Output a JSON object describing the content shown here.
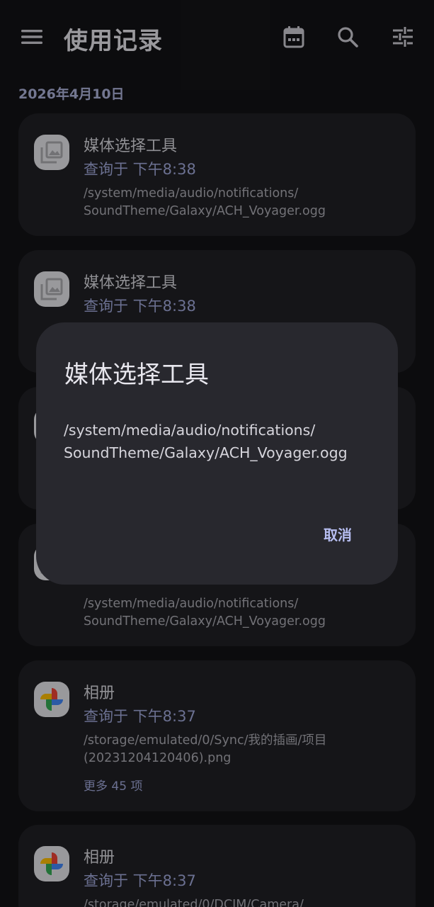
{
  "appbar": {
    "title": "使用记录",
    "icons": [
      "menu-icon",
      "calendar-icon",
      "search-icon",
      "tune-icon"
    ]
  },
  "date_header": "2026年4月10日",
  "cards": [
    {
      "icon": "gallery-icon",
      "app_name": "媒体选择工具",
      "time": "查询于 下午8:38",
      "path_line1": "/system/media/audio/notifications/",
      "path_line2": "SoundTheme/Galaxy/ACH_Voyager.ogg"
    },
    {
      "icon": "gallery-icon",
      "app_name": "媒体选择工具",
      "time": "查询于 下午8:38",
      "path_line1": "",
      "path_line2": ""
    },
    {
      "icon": "gallery-icon",
      "app_name": "",
      "time": "",
      "path_line1": "",
      "path_line2": ""
    },
    {
      "icon": "gallery-icon",
      "app_name": "",
      "time": "",
      "path_line1": "/system/media/audio/notifications/",
      "path_line2": "SoundTheme/Galaxy/ACH_Voyager.ogg"
    },
    {
      "icon": "photos-pinwheel-icon",
      "app_name": "相册",
      "time": "查询于 下午8:37",
      "path_line1": "/storage/emulated/0/Sync/我的插画/项目",
      "path_line2": "(20231204120406).png",
      "more": "更多 45 项"
    },
    {
      "icon": "photos-pinwheel-icon",
      "app_name": "相册",
      "time": "查询于 下午8:37",
      "path_line1": "/storage/emulated/0/DCIM/Camera/",
      "path_line2": ""
    }
  ],
  "dialog": {
    "title": "媒体选择工具",
    "body_line1": "/system/media/audio/notifications/",
    "body_line2": "SoundTheme/Galaxy/ACH_Voyager.ogg",
    "cancel_label": "取消"
  }
}
